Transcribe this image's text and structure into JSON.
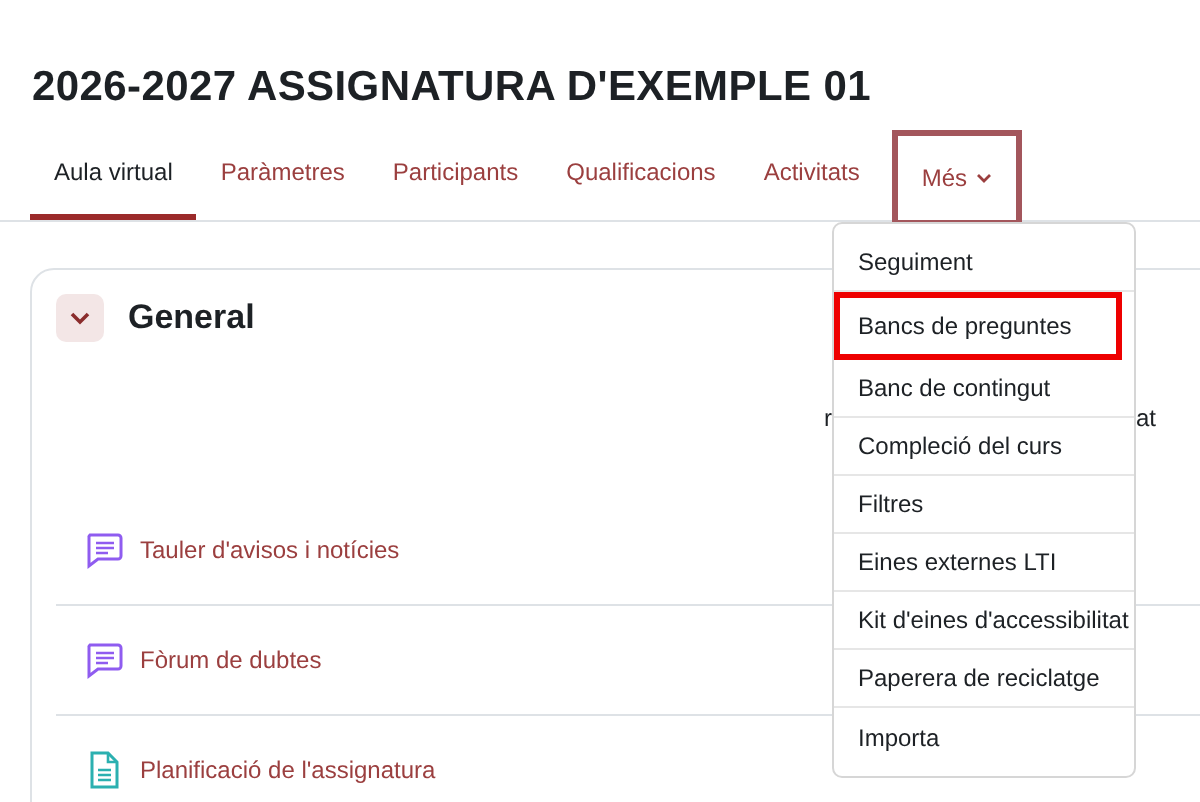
{
  "course_title": "2026-2027 ASSIGNATURA D'EXEMPLE 01",
  "tabs": [
    {
      "label": "Aula virtual",
      "selected": true,
      "highlighted": false
    },
    {
      "label": "Paràmetres",
      "selected": false,
      "highlighted": false
    },
    {
      "label": "Participants",
      "selected": false,
      "highlighted": false
    },
    {
      "label": "Qualificacions",
      "selected": false,
      "highlighted": false
    },
    {
      "label": "Activitats",
      "selected": false,
      "highlighted": false
    },
    {
      "label": "Més",
      "selected": false,
      "highlighted": true,
      "dropdown": true
    }
  ],
  "more_menu": [
    {
      "label": "Seguiment",
      "highlighted": false
    },
    {
      "label": "Bancs de preguntes",
      "highlighted": true
    },
    {
      "label": "Banc de contingut",
      "highlighted": false
    },
    {
      "label": "Compleció del curs",
      "highlighted": false
    },
    {
      "label": "Filtres",
      "highlighted": false
    },
    {
      "label": "Eines externes LTI",
      "highlighted": false
    },
    {
      "label": "Kit d'eines d'accessibilitat",
      "highlighted": false
    },
    {
      "label": "Paperera de reciclatge",
      "highlighted": false
    },
    {
      "label": "Importa",
      "highlighted": false
    }
  ],
  "section": {
    "title": "General",
    "expanded": true,
    "hidden_text_fragments": [
      "r",
      "at"
    ],
    "activities": [
      {
        "kind": "forum",
        "name": "Tauler d'avisos i notícies"
      },
      {
        "kind": "forum",
        "name": "Fòrum de dubtes"
      },
      {
        "kind": "file",
        "name": "Planificació de l'assignatura"
      }
    ]
  }
}
